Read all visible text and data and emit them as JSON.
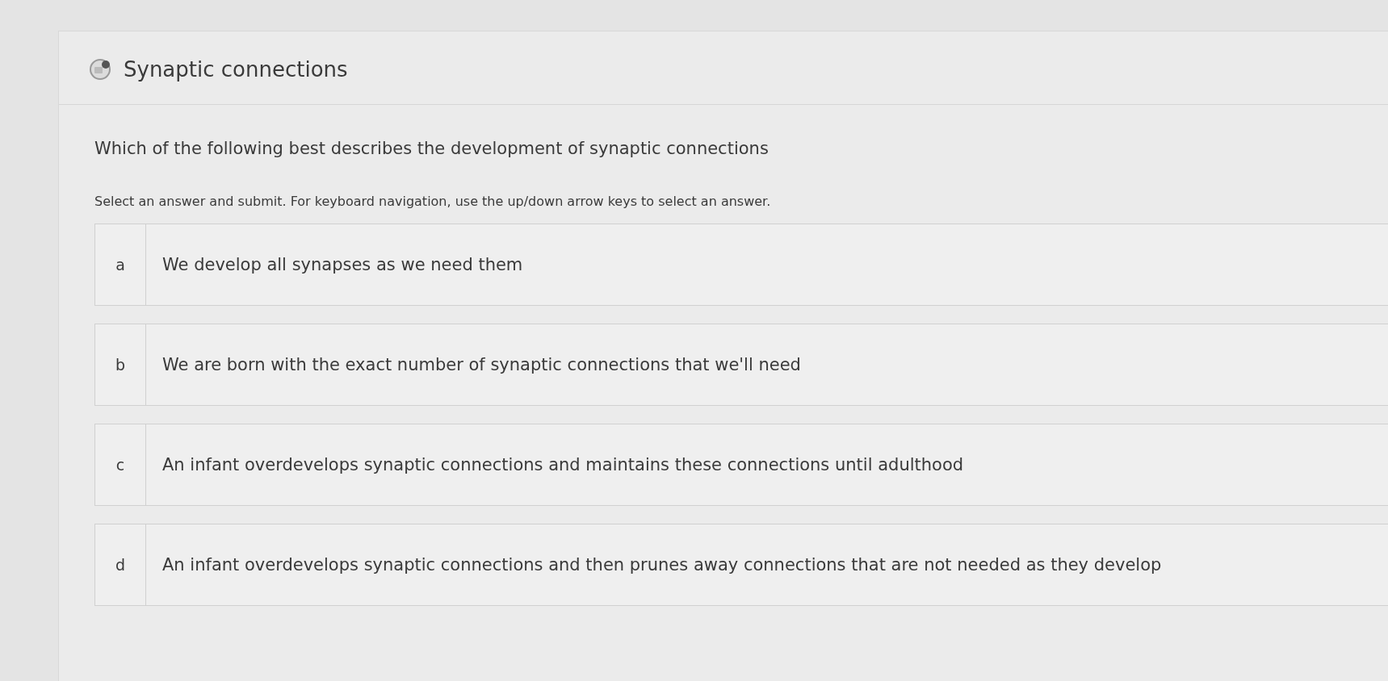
{
  "header": {
    "title": "Synaptic connections"
  },
  "question": "Which of the following best describes the development of synaptic connections",
  "instructions": "Select an answer and submit. For keyboard navigation, use the up/down arrow keys to select an answer.",
  "options": [
    {
      "letter": "a",
      "text": "We develop all synapses as we need them",
      "selected": false
    },
    {
      "letter": "b",
      "text": "We are born with the exact number of synaptic connections that we'll need",
      "selected": false
    },
    {
      "letter": "c",
      "text": "An infant overdevelops synaptic connections and maintains these connections until adulthood",
      "selected": false
    },
    {
      "letter": "d",
      "text": "An infant overdevelops synaptic connections and then prunes away connections that are not needed as they develop",
      "selected": false
    }
  ]
}
